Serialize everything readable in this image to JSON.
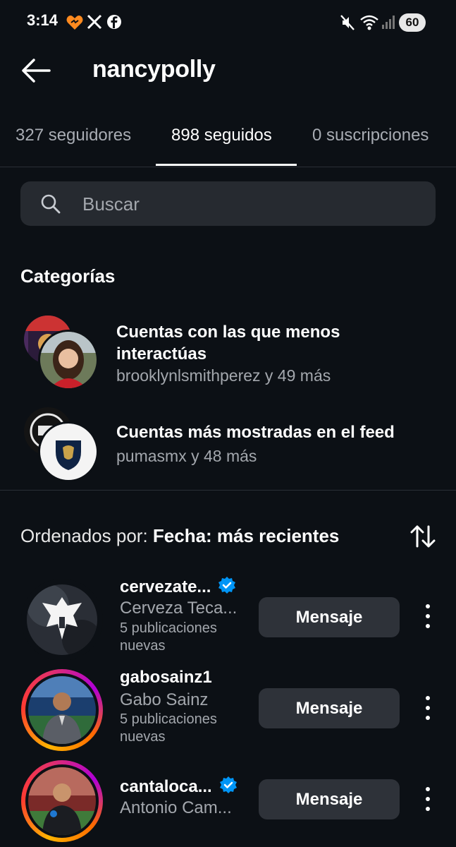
{
  "status_bar": {
    "time": "3:14",
    "battery": "60",
    "left_icons": [
      "heart-app-icon",
      "x-icon",
      "facebook-icon"
    ],
    "right_icons": [
      "mute-icon",
      "wifi-icon",
      "signal-icon",
      "battery-icon"
    ]
  },
  "header": {
    "username": "nancypolly"
  },
  "tabs": [
    {
      "label": "327 seguidores",
      "active": false
    },
    {
      "label": "898 seguidos",
      "active": true
    },
    {
      "label": "0 suscripciones",
      "active": false
    }
  ],
  "search": {
    "placeholder": "Buscar"
  },
  "categories": {
    "heading": "Categorías",
    "items": [
      {
        "title": "Cuentas con las que menos interactúas",
        "subtitle": "brooklynlsmithperez y 49 más"
      },
      {
        "title": "Cuentas más mostradas en el feed",
        "subtitle": "pumasmx y 48 más"
      }
    ]
  },
  "sort": {
    "prefix": "Ordenados por: ",
    "value": "Fecha: más recientes"
  },
  "users": [
    {
      "handle": "cervezate...",
      "verified": true,
      "name": "Cerveza Teca...",
      "meta": "5 publicaciones nuevas",
      "button": "Mensaje",
      "story_ring": false
    },
    {
      "handle": "gabosainz1",
      "verified": false,
      "name": "Gabo Sainz",
      "meta": "5 publicaciones nuevas",
      "button": "Mensaje",
      "story_ring": true
    },
    {
      "handle": "cantaloca...",
      "verified": true,
      "name": "Antonio Cam...",
      "meta": "",
      "button": "Mensaje",
      "story_ring": true
    }
  ],
  "colors": {
    "background": "#0c1015",
    "verified_blue": "#0095f6",
    "button_bg": "#2e3239",
    "search_bg": "#262a30"
  }
}
